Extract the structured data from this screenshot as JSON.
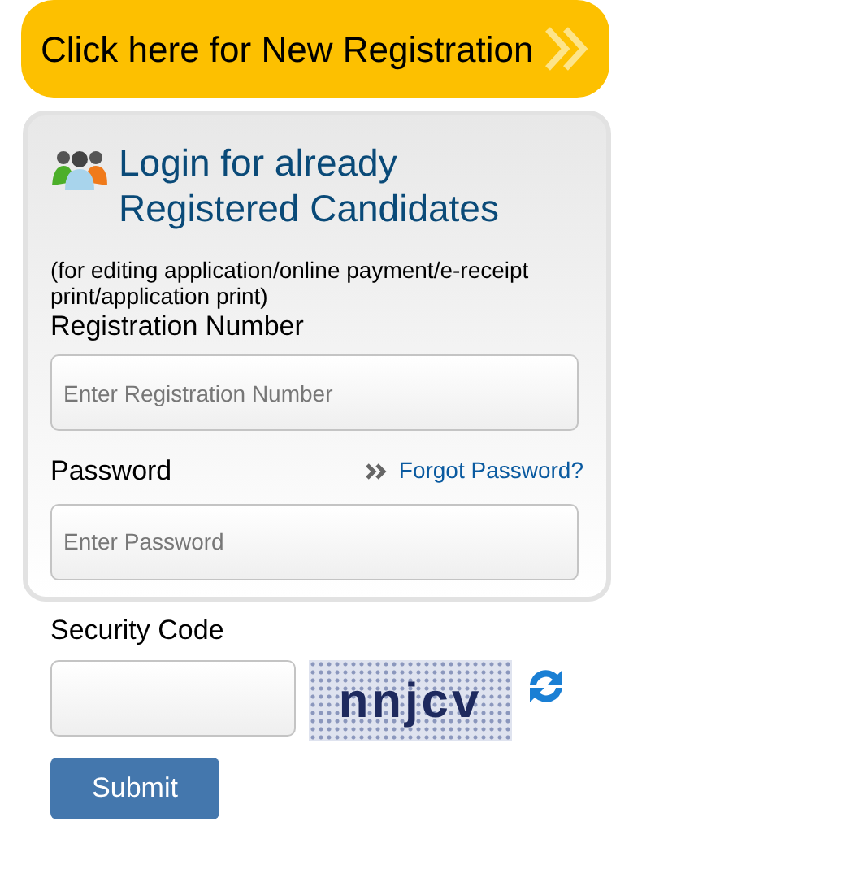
{
  "new_registration": {
    "label": "Click here for New Registration"
  },
  "login": {
    "title_line_1": "Login for already",
    "title_line_2": "Registered Candidates",
    "note": "(for editing application/online payment/e-receipt print/application print)",
    "registration_number": {
      "label": "Registration Number",
      "placeholder": "Enter Registration Number"
    },
    "password": {
      "label": "Password",
      "placeholder": "Enter Password"
    },
    "forgot_password": "Forgot Password?"
  },
  "security_code": {
    "label": "Security Code",
    "captcha": "nnjcv"
  },
  "submit": "Submit"
}
